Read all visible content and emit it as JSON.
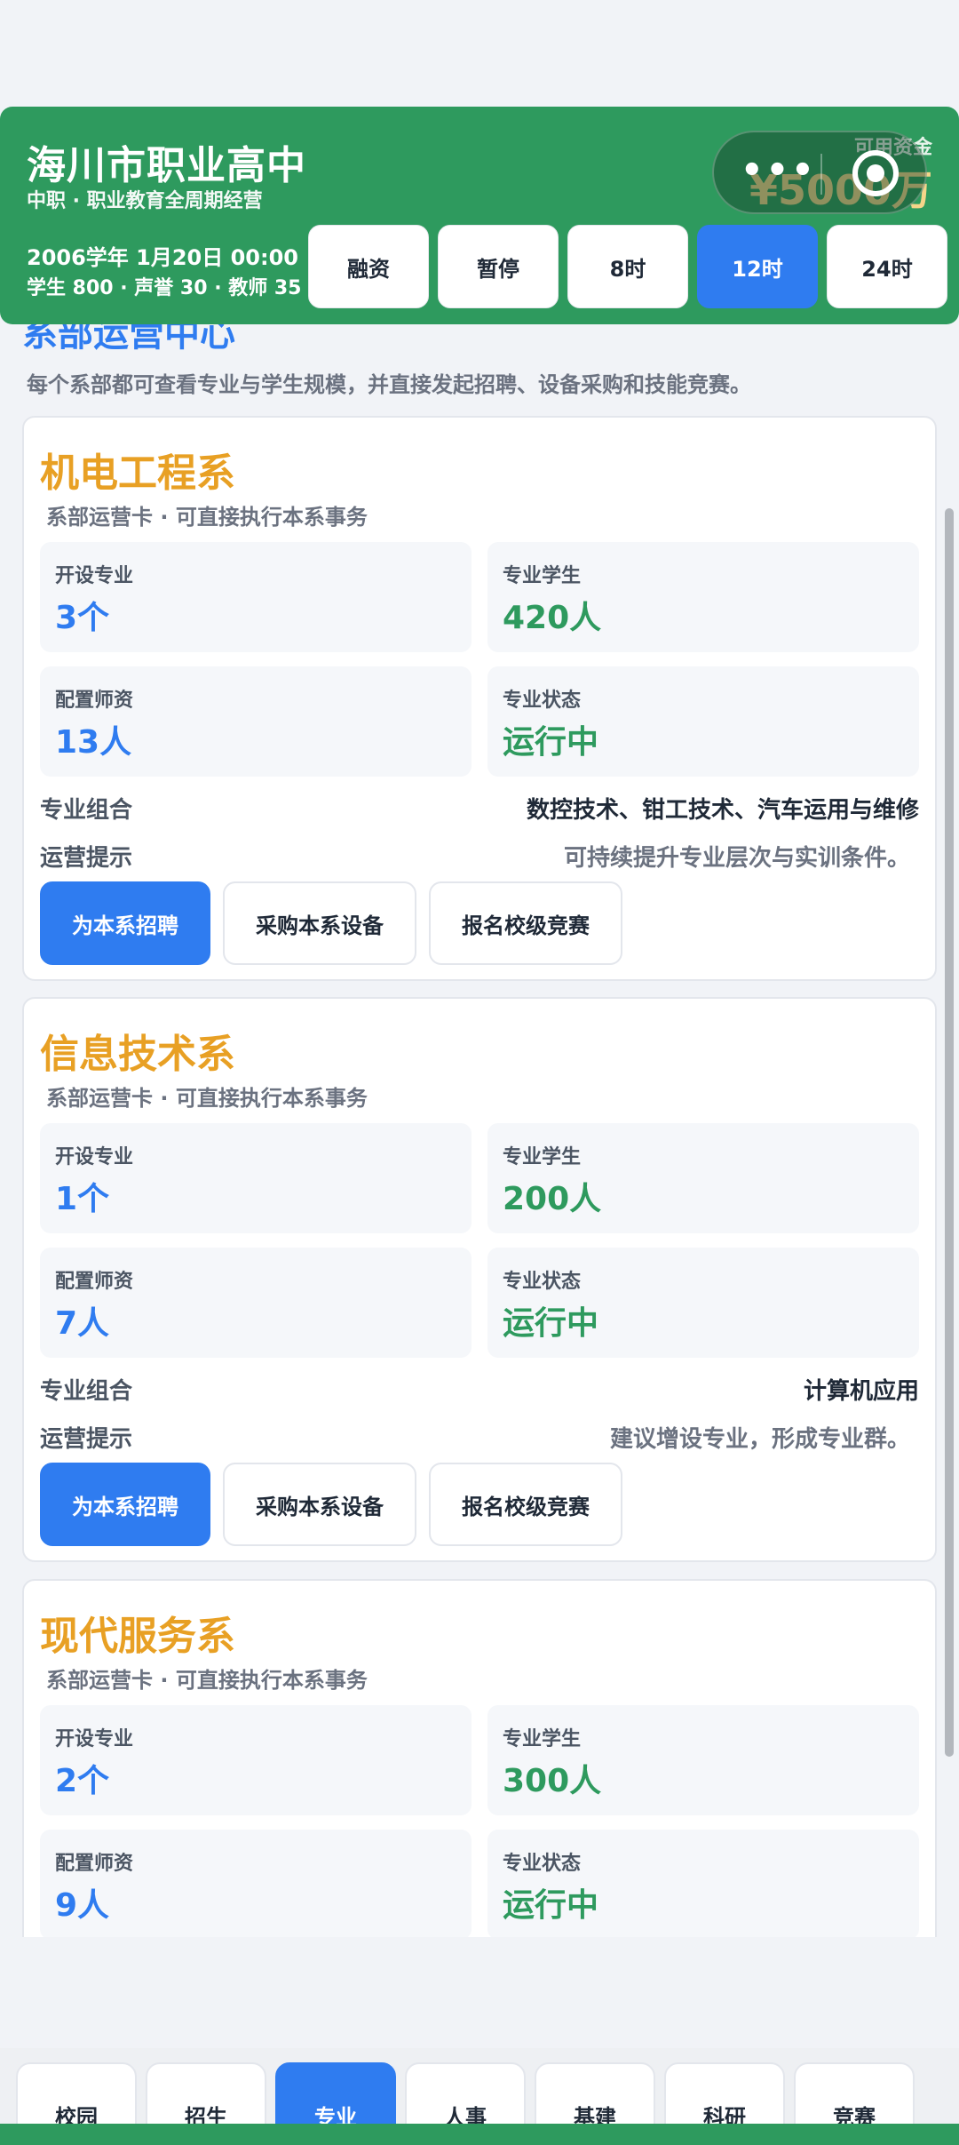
{
  "header": {
    "school_name": "海川市职业高中",
    "subtitle": "中职 · 职业教育全周期经营",
    "date": "2006学年 1月20日 00:00",
    "stats": "学生 800 · 声誉 30 · 教师 35",
    "fund_label": "可用资金",
    "fund_value": "¥5000万",
    "speed_buttons": [
      "融资",
      "暂停",
      "8时",
      "12时",
      "24时"
    ],
    "active_speed": "12时",
    "capsule_dots": "•••"
  },
  "section": {
    "title": "系部运营中心",
    "description": "每个系部都可查看专业与学生规模，并直接发起招聘、设备采购和技能竞赛。"
  },
  "labels": {
    "card_sub": "系部运营卡 · 可直接执行本系事务",
    "majors_open": "开设专业",
    "students": "专业学生",
    "teachers": "配置师资",
    "status": "专业状态",
    "combo": "专业组合",
    "tip": "运营提示",
    "recruit": "为本系招聘",
    "purchase": "采购本系设备",
    "compete": "报名校级竞赛"
  },
  "departments": [
    {
      "name": "机电工程系",
      "majors_count": "3个",
      "students": "420人",
      "teachers": "13人",
      "status": "运行中",
      "combo": "数控技术、钳工技术、汽车运用与维修",
      "tip": "可持续提升专业层次与实训条件。"
    },
    {
      "name": "信息技术系",
      "majors_count": "1个",
      "students": "200人",
      "teachers": "7人",
      "status": "运行中",
      "combo": "计算机应用",
      "tip": "建议增设专业，形成专业群。"
    },
    {
      "name": "现代服务系",
      "majors_count": "2个",
      "students": "300人",
      "teachers": "9人",
      "status": "运行中",
      "combo": "",
      "tip": ""
    }
  ],
  "tabs": [
    "校园",
    "招生",
    "专业",
    "人事",
    "基建",
    "科研",
    "竞赛"
  ],
  "active_tab": "专业",
  "colors": {
    "header_green": "#2e9a5e",
    "accent_blue": "#2f7cf0",
    "dept_orange": "#e8a024",
    "fund_gold": "#f4d58a"
  }
}
